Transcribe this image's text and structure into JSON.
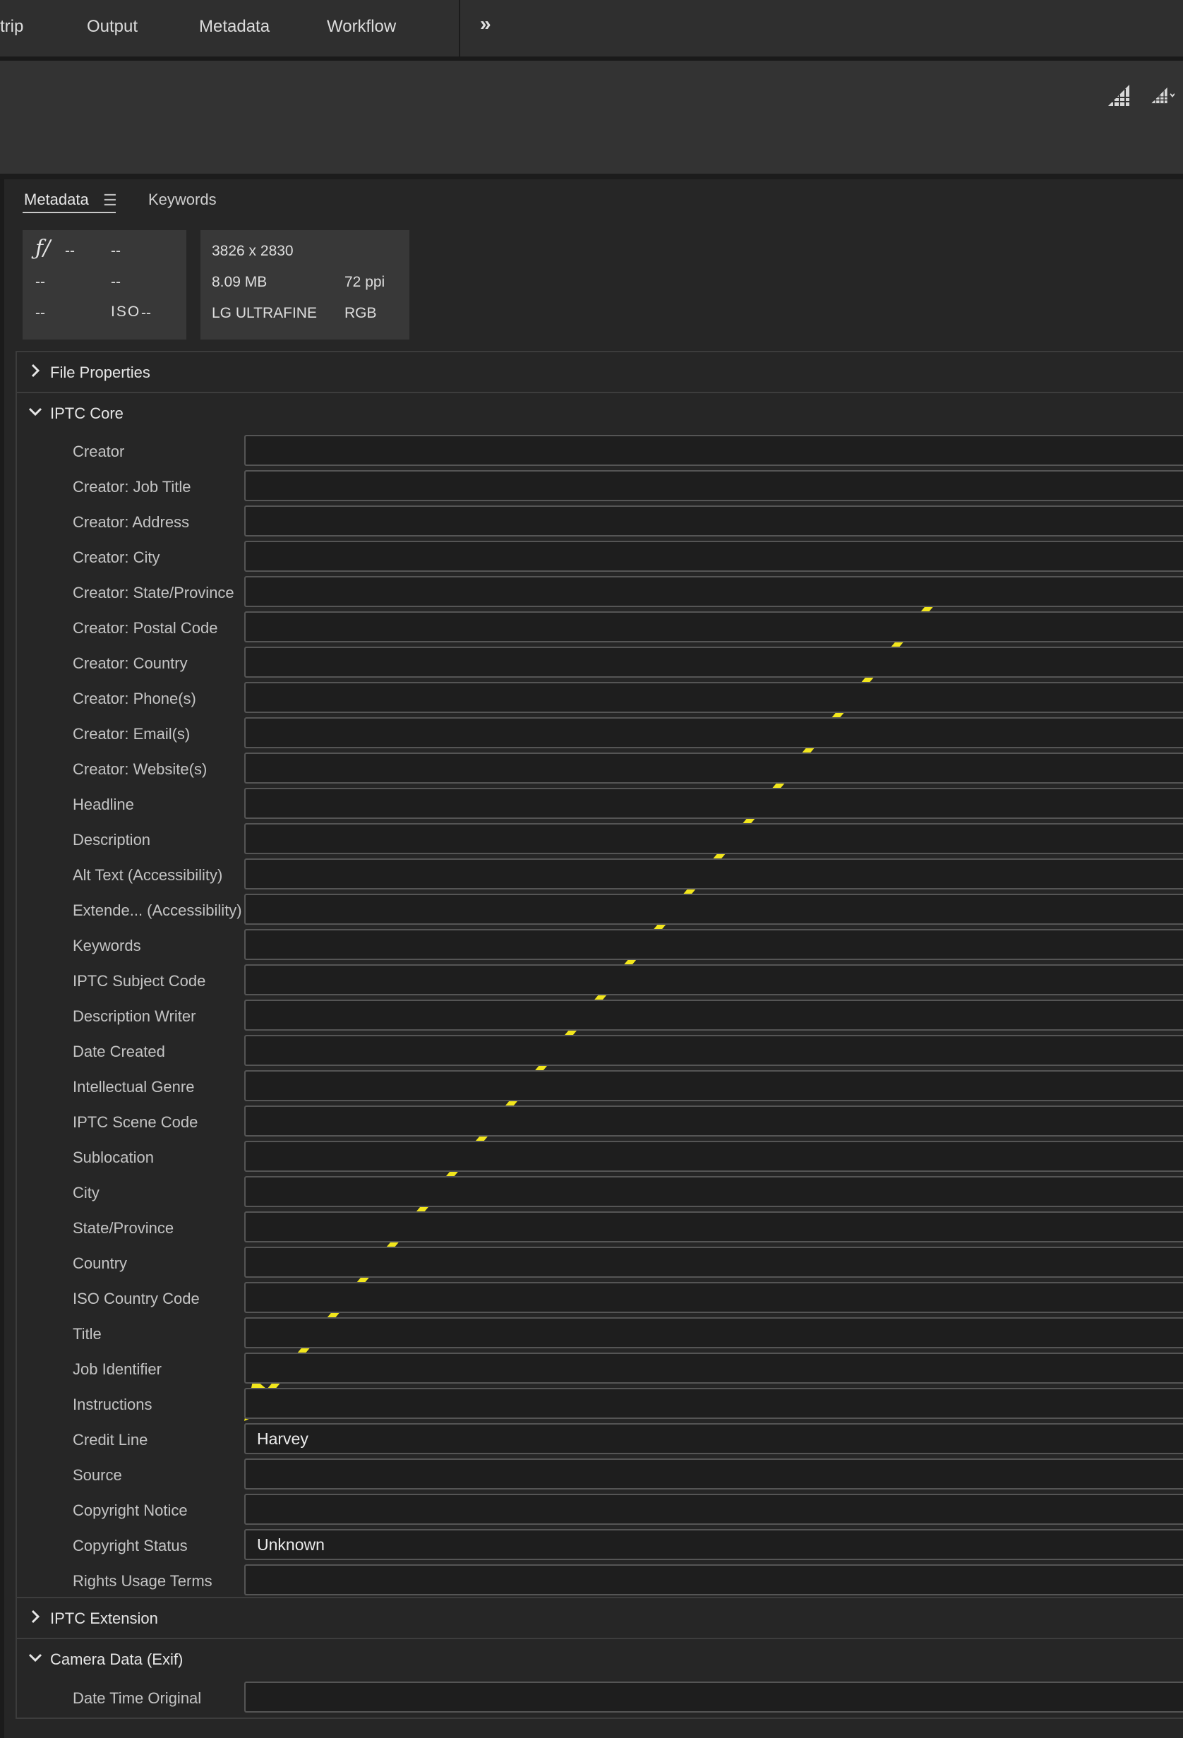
{
  "workspaces": {
    "filmstrip": "trip",
    "output": "Output",
    "metadata": "Metadata",
    "workflow": "Workflow",
    "more": "»"
  },
  "panel": {
    "tabs": {
      "metadata": "Metadata",
      "keywords": "Keywords",
      "menu_icon": "☰"
    },
    "camera_info": {
      "aperture_symbol": "ƒ/",
      "aperture": "--",
      "shutter": "--",
      "exposure_comp": "--",
      "focal_length": "--",
      "metering": "--",
      "iso_label": "ISO",
      "iso_value": "--"
    },
    "file_info": {
      "dimensions": "3826 x 2830",
      "file_size": "8.09 MB",
      "resolution": "72 ppi",
      "color_profile": "LG ULTRAFINE",
      "color_mode": "RGB"
    }
  },
  "sections": {
    "file_properties": {
      "title": "File Properties",
      "expanded": false
    },
    "iptc_core": {
      "title": "IPTC Core",
      "expanded": true,
      "fields": [
        {
          "label": "Creator",
          "value": ""
        },
        {
          "label": "Creator: Job Title",
          "value": ""
        },
        {
          "label": "Creator: Address",
          "value": ""
        },
        {
          "label": "Creator: City",
          "value": ""
        },
        {
          "label": "Creator: State/Province",
          "value": ""
        },
        {
          "label": "Creator: Postal Code",
          "value": ""
        },
        {
          "label": "Creator: Country",
          "value": ""
        },
        {
          "label": "Creator: Phone(s)",
          "value": ""
        },
        {
          "label": "Creator: Email(s)",
          "value": ""
        },
        {
          "label": "Creator: Website(s)",
          "value": ""
        },
        {
          "label": "Headline",
          "value": ""
        },
        {
          "label": "Description",
          "value": ""
        },
        {
          "label": "Alt Text (Accessibility)",
          "value": ""
        },
        {
          "label": "Extende... (Accessibility)",
          "value": ""
        },
        {
          "label": "Keywords",
          "value": ""
        },
        {
          "label": "IPTC Subject Code",
          "value": ""
        },
        {
          "label": "Description Writer",
          "value": ""
        },
        {
          "label": "Date Created",
          "value": ""
        },
        {
          "label": "Intellectual Genre",
          "value": ""
        },
        {
          "label": "IPTC Scene Code",
          "value": ""
        },
        {
          "label": "Sublocation",
          "value": ""
        },
        {
          "label": "City",
          "value": ""
        },
        {
          "label": "State/Province",
          "value": ""
        },
        {
          "label": "Country",
          "value": ""
        },
        {
          "label": "ISO Country Code",
          "value": ""
        },
        {
          "label": "Title",
          "value": ""
        },
        {
          "label": "Job Identifier",
          "value": ""
        },
        {
          "label": "Instructions",
          "value": ""
        },
        {
          "label": "Credit Line",
          "value": "Harvey"
        },
        {
          "label": "Source",
          "value": ""
        },
        {
          "label": "Copyright Notice",
          "value": ""
        },
        {
          "label": "Copyright Status",
          "value": "Unknown"
        },
        {
          "label": "Rights Usage Terms",
          "value": ""
        }
      ]
    },
    "iptc_extension": {
      "title": "IPTC Extension",
      "expanded": false
    },
    "camera_data": {
      "title": "Camera Data (Exif)",
      "expanded": true,
      "fields": [
        {
          "label": "Date Time Original",
          "value": ""
        }
      ]
    }
  },
  "annotation": {
    "color": "#f2e61c",
    "target": "Credit Line"
  }
}
